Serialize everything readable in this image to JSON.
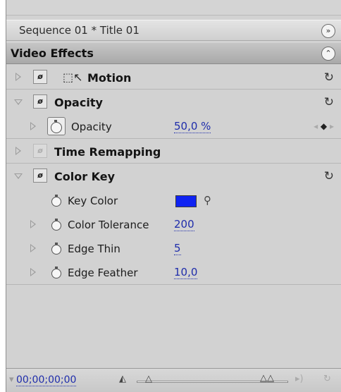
{
  "panel": {
    "sequence_title": "Sequence 01 * Title 01",
    "section_title": "Video Effects"
  },
  "effects": {
    "motion": {
      "label": "Motion"
    },
    "opacity": {
      "label": "Opacity",
      "param_label": "Opacity",
      "param_value": "50,0 %"
    },
    "time_remapping": {
      "label": "Time Remapping"
    },
    "color_key": {
      "label": "Color Key",
      "key_color_label": "Key Color",
      "key_color": "#0f23f2",
      "tolerance_label": "Color Tolerance",
      "tolerance_value": "200",
      "edge_thin_label": "Edge Thin",
      "edge_thin_value": "5",
      "edge_feather_label": "Edge Feather",
      "edge_feather_value": "10,0"
    }
  },
  "footer": {
    "timecode": "00;00;00;00"
  },
  "icons": {
    "fx": "fx-badge-icon",
    "reset": "reset-icon",
    "stopwatch": "stopwatch-icon",
    "eyedropper": "eyedropper-icon",
    "expand": "expand-triangle-icon",
    "collapse": "collapse-triangle-icon"
  }
}
